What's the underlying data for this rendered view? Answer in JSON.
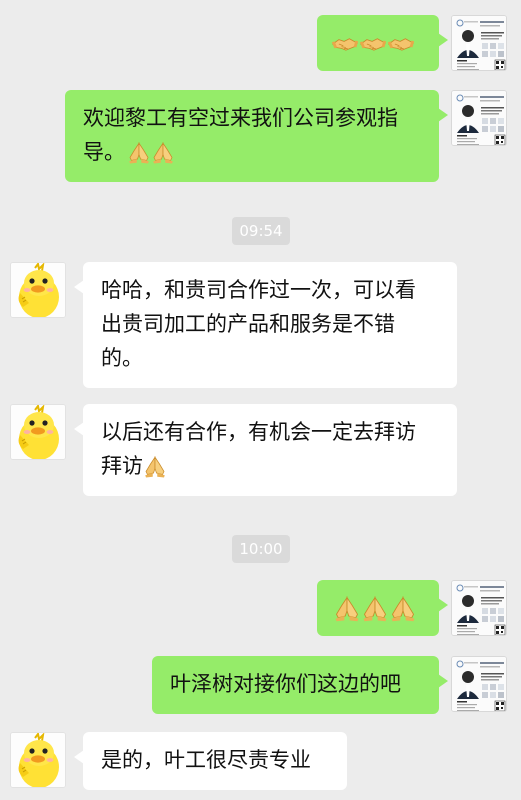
{
  "messages": [
    {
      "side": "right",
      "sender": "business-card",
      "text": "",
      "emoji": [
        "handshake",
        "handshake",
        "handshake"
      ]
    },
    {
      "side": "right",
      "sender": "business-card",
      "text": "欢迎黎工有空过来我们公司参观指导。",
      "emoji": [
        "pray",
        "pray"
      ]
    },
    {
      "timestamp": "09:54"
    },
    {
      "side": "left",
      "sender": "duck",
      "text": "哈哈，和贵司合作过一次，可以看出贵司加工的产品和服务是不错的。",
      "emoji": []
    },
    {
      "side": "left",
      "sender": "duck",
      "text": "以后还有合作，有机会一定去拜访拜访",
      "emoji": [
        "pray"
      ]
    },
    {
      "timestamp": "10:00"
    },
    {
      "side": "right",
      "sender": "business-card",
      "text": "",
      "emoji": [
        "pray",
        "pray",
        "pray"
      ]
    },
    {
      "side": "right",
      "sender": "business-card",
      "text": "叶泽树对接你们这边的吧",
      "emoji": []
    },
    {
      "side": "left",
      "sender": "duck",
      "text": "是的，叶工很尽责专业",
      "emoji": []
    }
  ],
  "chat": {
    "msg1_text": "",
    "msg2_line1": "欢迎黎工有空过来我们公司参观指",
    "msg2_line2": "导。",
    "ts1": "09:54",
    "msg3_line1": "哈哈，和贵司合作过一次，可以看",
    "msg3_line2": "出贵司加工的产品和服务是不错",
    "msg3_line3": "的。",
    "msg4_line1": "以后还有合作，有机会一定去拜访",
    "msg4_line2": "拜访",
    "ts2": "10:00",
    "msg6_text": "叶泽树对接你们这边的吧",
    "msg7_text": "是的，叶工很尽责专业"
  },
  "colors": {
    "background": "#ececec",
    "outgoing_bubble": "#95ec69",
    "incoming_bubble": "#ffffff",
    "timestamp_bg": "#dadada"
  },
  "icons": {
    "handshake": "handshake-emoji",
    "pray": "pray-emoji",
    "avatar_right": "business-card-avatar",
    "avatar_left": "yellow-duck-avatar"
  }
}
